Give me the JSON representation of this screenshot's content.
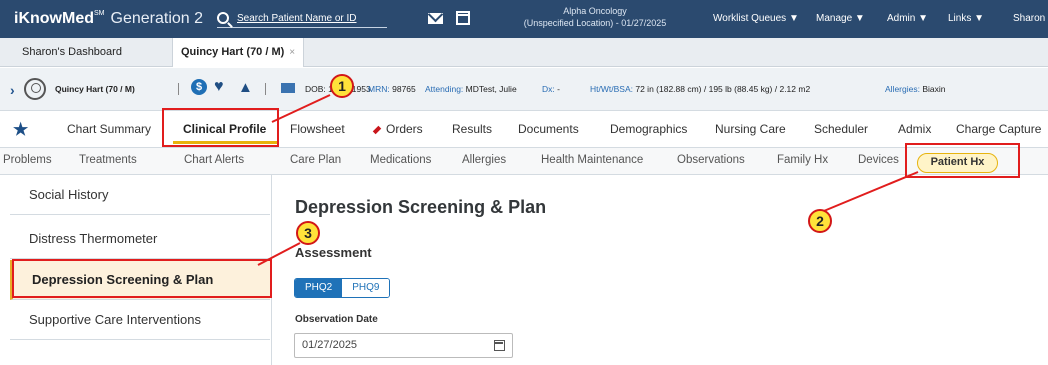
{
  "header": {
    "brand": "iKnowMed",
    "brand_mark": "SM",
    "generation": "Generation 2",
    "search_placeholder": "Search Patient Name or ID",
    "location_line1": "Alpha Oncology",
    "location_line2": "(Unspecified Location) - 01/27/2025",
    "menus": [
      "Worklist Queues ▼",
      "Manage ▼",
      "Admin ▼",
      "Links ▼",
      "Sharon"
    ]
  },
  "dashboard_tabs": {
    "tab1": "Sharon's Dashboard",
    "tab2": "Quincy Hart (70 / M)",
    "close": "×"
  },
  "banner": {
    "patient": "Quincy Hart (70 / M)",
    "dob_label": "DOB:",
    "dob": "12/07/1953",
    "mrn_label": "MRN:",
    "mrn": "98765",
    "attending_label": "Attending:",
    "attending": "MDTest, Julie",
    "dx_label": "Dx:",
    "dx": "-",
    "htwt_label": "Ht/Wt/BSA:",
    "htwt": "72 in (182.88 cm) / 195 lb (88.45 kg) / 2.12 m2",
    "allergies_label": "Allergies:",
    "allergies": "Biaxin"
  },
  "main_nav": [
    "Chart Summary",
    "Clinical Profile",
    "Flowsheet",
    "Orders",
    "Results",
    "Documents",
    "Demographics",
    "Nursing Care",
    "Scheduler",
    "Admix",
    "Charge Capture"
  ],
  "sub_nav": [
    "Problems",
    "Treatments",
    "Chart Alerts",
    "Care Plan",
    "Medications",
    "Allergies",
    "Health Maintenance",
    "Observations",
    "Family Hx",
    "Devices",
    "Patient Hx"
  ],
  "sidebar": [
    "Social History",
    "Distress Thermometer",
    "Depression Screening & Plan",
    "Supportive Care Interventions"
  ],
  "content": {
    "title": "Depression Screening & Plan",
    "section": "Assessment",
    "seg_on": "PHQ2",
    "seg_off": "PHQ9",
    "date_label": "Observation Date",
    "date_value": "01/27/2025"
  },
  "annotations": {
    "n1": "1",
    "n2": "2",
    "n3": "3",
    "color": "#e11d1d"
  }
}
